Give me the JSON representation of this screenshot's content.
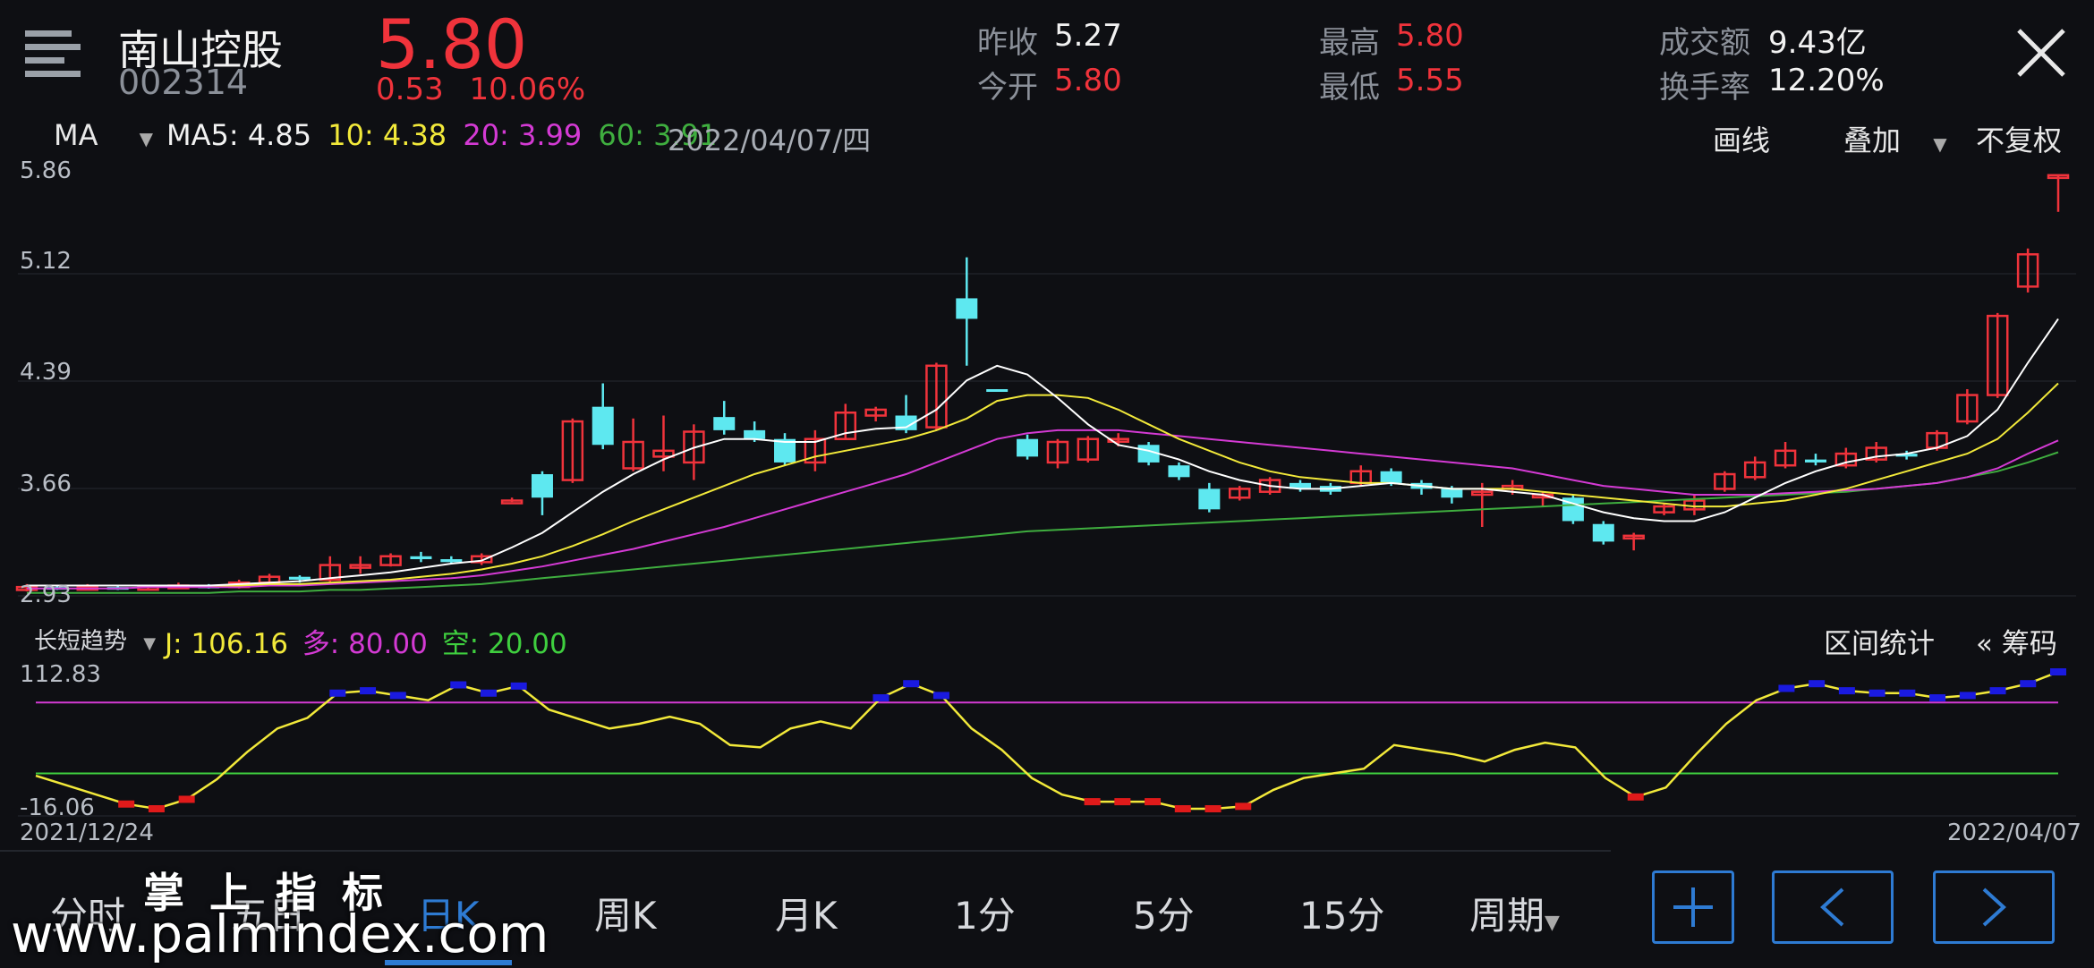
{
  "header": {
    "name": "南山控股",
    "code": "002314",
    "price": "5.80",
    "change": "0.53",
    "change_pct": "10.06%",
    "stats": [
      {
        "label": "昨收",
        "value": "5.27",
        "color": "#f2f2f2"
      },
      {
        "label": "今开",
        "value": "5.80",
        "color": "#f0333b"
      },
      {
        "label": "最高",
        "value": "5.80",
        "color": "#f0333b"
      },
      {
        "label": "最低",
        "value": "5.55",
        "color": "#f0333b"
      },
      {
        "label": "成交额",
        "value": "9.43亿",
        "color": "#f2f2f2"
      },
      {
        "label": "换手率",
        "value": "12.20%",
        "color": "#f2f2f2"
      }
    ]
  },
  "toolbar": {
    "indicator": "MA",
    "ma5": "MA5: 4.85",
    "ma10": "10: 4.38",
    "ma20": "20: 3.99",
    "ma60": "60: 3.91",
    "date": "2022/04/07/四",
    "draw": "画线",
    "overlay": "叠加",
    "adjust": "不复权"
  },
  "colors": {
    "up": "#f0333b",
    "down": "#5ee8f0",
    "ma5": "#ffffff",
    "ma10": "#f2e93a",
    "ma20": "#d43ad4",
    "ma60": "#3fae3f"
  },
  "chart_data": {
    "type": "candlestick",
    "y_ticks": [
      "5.86",
      "5.12",
      "4.39",
      "3.66",
      "2.93"
    ],
    "ylim": [
      2.93,
      5.86
    ],
    "x_labels": {
      "start": "2021/12/24",
      "end": "2022/04/07"
    },
    "candles": [
      [
        2.97,
        2.99,
        3.01,
        2.96
      ],
      [
        2.99,
        2.98,
        3.0,
        2.97
      ],
      [
        2.98,
        2.99,
        3.01,
        2.97
      ],
      [
        2.99,
        2.98,
        3.0,
        2.97
      ],
      [
        2.98,
        2.99,
        3.0,
        2.97
      ],
      [
        2.99,
        3.0,
        3.02,
        2.98
      ],
      [
        3.0,
        2.99,
        3.01,
        2.98
      ],
      [
        2.99,
        3.02,
        3.04,
        2.98
      ],
      [
        3.02,
        3.06,
        3.08,
        3.01
      ],
      [
        3.06,
        3.04,
        3.07,
        3.02
      ],
      [
        3.04,
        3.14,
        3.2,
        3.02
      ],
      [
        3.14,
        3.14,
        3.2,
        3.08
      ],
      [
        3.14,
        3.2,
        3.22,
        3.13
      ],
      [
        3.2,
        3.18,
        3.23,
        3.16
      ],
      [
        3.18,
        3.16,
        3.2,
        3.15
      ],
      [
        3.16,
        3.2,
        3.22,
        3.14
      ],
      [
        3.58,
        3.58,
        3.6,
        3.57
      ],
      [
        3.76,
        3.6,
        3.78,
        3.48
      ],
      [
        3.72,
        4.12,
        4.14,
        3.7
      ],
      [
        4.22,
        3.96,
        4.38,
        3.93
      ],
      [
        3.8,
        3.98,
        4.14,
        3.78
      ],
      [
        3.88,
        3.92,
        4.16,
        3.78
      ],
      [
        3.84,
        4.05,
        4.1,
        3.72
      ],
      [
        4.15,
        4.06,
        4.26,
        4.03
      ],
      [
        4.06,
        4.0,
        4.12,
        3.98
      ],
      [
        4.0,
        3.84,
        4.04,
        3.82
      ],
      [
        3.84,
        4.0,
        4.06,
        3.78
      ],
      [
        4.0,
        4.18,
        4.24,
        4.0
      ],
      [
        4.16,
        4.2,
        4.22,
        4.12
      ],
      [
        4.16,
        4.06,
        4.3,
        4.04
      ],
      [
        4.08,
        4.5,
        4.52,
        4.06
      ],
      [
        4.96,
        4.82,
        5.24,
        4.5
      ],
      [
        4.34,
        4.33,
        4.34,
        4.33
      ],
      [
        4.0,
        3.88,
        4.03,
        3.86
      ],
      [
        3.84,
        3.98,
        4.0,
        3.8
      ],
      [
        3.86,
        4.0,
        4.02,
        3.84
      ],
      [
        3.99,
        4.0,
        4.04,
        3.95
      ],
      [
        3.96,
        3.84,
        3.98,
        3.82
      ],
      [
        3.82,
        3.74,
        3.84,
        3.72
      ],
      [
        3.66,
        3.52,
        3.7,
        3.5
      ],
      [
        3.6,
        3.66,
        3.68,
        3.58
      ],
      [
        3.64,
        3.72,
        3.74,
        3.62
      ],
      [
        3.7,
        3.66,
        3.72,
        3.64
      ],
      [
        3.68,
        3.64,
        3.7,
        3.62
      ],
      [
        3.7,
        3.78,
        3.82,
        3.68
      ],
      [
        3.78,
        3.7,
        3.8,
        3.68
      ],
      [
        3.7,
        3.66,
        3.72,
        3.62
      ],
      [
        3.66,
        3.6,
        3.68,
        3.56
      ],
      [
        3.62,
        3.64,
        3.7,
        3.4
      ],
      [
        3.66,
        3.68,
        3.72,
        3.62
      ],
      [
        3.62,
        3.62,
        3.64,
        3.54
      ],
      [
        3.6,
        3.44,
        3.62,
        3.42
      ],
      [
        3.42,
        3.3,
        3.44,
        3.28
      ],
      [
        3.34,
        3.34,
        3.36,
        3.24
      ],
      [
        3.5,
        3.54,
        3.56,
        3.48
      ],
      [
        3.52,
        3.58,
        3.62,
        3.48
      ],
      [
        3.66,
        3.76,
        3.78,
        3.64
      ],
      [
        3.74,
        3.84,
        3.88,
        3.72
      ],
      [
        3.82,
        3.92,
        3.98,
        3.8
      ],
      [
        3.86,
        3.84,
        3.9,
        3.82
      ],
      [
        3.82,
        3.9,
        3.94,
        3.8
      ],
      [
        3.86,
        3.94,
        3.98,
        3.84
      ],
      [
        3.9,
        3.88,
        3.92,
        3.86
      ],
      [
        3.94,
        4.04,
        4.06,
        3.92
      ],
      [
        4.12,
        4.3,
        4.34,
        4.1
      ],
      [
        4.3,
        4.84,
        4.86,
        4.28
      ],
      [
        5.04,
        5.26,
        5.3,
        5.0
      ],
      [
        5.8,
        5.8,
        5.8,
        5.55
      ]
    ],
    "ma5": [
      3.0,
      3.0,
      3.0,
      3.0,
      3.0,
      3.0,
      3.0,
      3.01,
      3.02,
      3.03,
      3.05,
      3.07,
      3.09,
      3.12,
      3.15,
      3.17,
      3.26,
      3.36,
      3.5,
      3.64,
      3.76,
      3.86,
      3.94,
      4.0,
      4.0,
      3.98,
      3.98,
      4.04,
      4.07,
      4.08,
      4.2,
      4.4,
      4.5,
      4.44,
      4.28,
      4.1,
      3.96,
      3.92,
      3.86,
      3.78,
      3.72,
      3.68,
      3.66,
      3.66,
      3.68,
      3.7,
      3.68,
      3.66,
      3.66,
      3.64,
      3.62,
      3.56,
      3.5,
      3.46,
      3.44,
      3.44,
      3.5,
      3.6,
      3.7,
      3.78,
      3.84,
      3.88,
      3.9,
      3.94,
      4.02,
      4.2,
      4.52,
      4.82
    ],
    "ma10": [
      3.0,
      3.0,
      3.0,
      3.0,
      3.0,
      3.0,
      3.0,
      3.0,
      3.01,
      3.01,
      3.02,
      3.03,
      3.04,
      3.06,
      3.08,
      3.11,
      3.15,
      3.2,
      3.27,
      3.35,
      3.44,
      3.52,
      3.6,
      3.68,
      3.76,
      3.82,
      3.88,
      3.92,
      3.96,
      4.0,
      4.06,
      4.14,
      4.26,
      4.3,
      4.3,
      4.28,
      4.2,
      4.1,
      4.0,
      3.92,
      3.84,
      3.78,
      3.74,
      3.72,
      3.7,
      3.7,
      3.68,
      3.66,
      3.66,
      3.66,
      3.64,
      3.62,
      3.6,
      3.58,
      3.56,
      3.54,
      3.54,
      3.56,
      3.58,
      3.62,
      3.66,
      3.72,
      3.78,
      3.84,
      3.9,
      4.0,
      4.18,
      4.38
    ],
    "ma20": [
      2.98,
      2.98,
      2.98,
      2.98,
      2.99,
      2.99,
      2.99,
      2.99,
      3.0,
      3.0,
      3.01,
      3.02,
      3.03,
      3.04,
      3.05,
      3.07,
      3.1,
      3.13,
      3.17,
      3.21,
      3.25,
      3.3,
      3.35,
      3.4,
      3.46,
      3.52,
      3.58,
      3.64,
      3.7,
      3.76,
      3.84,
      3.92,
      4.0,
      4.04,
      4.06,
      4.06,
      4.06,
      4.04,
      4.02,
      4.0,
      3.98,
      3.96,
      3.94,
      3.92,
      3.9,
      3.88,
      3.86,
      3.84,
      3.82,
      3.8,
      3.76,
      3.72,
      3.68,
      3.66,
      3.64,
      3.62,
      3.62,
      3.62,
      3.63,
      3.64,
      3.65,
      3.66,
      3.68,
      3.7,
      3.74,
      3.8,
      3.9,
      3.99
    ],
    "ma60": [
      2.95,
      2.95,
      2.95,
      2.95,
      2.95,
      2.95,
      2.95,
      2.96,
      2.96,
      2.96,
      2.97,
      2.97,
      2.98,
      2.99,
      3.0,
      3.01,
      3.03,
      3.05,
      3.07,
      3.09,
      3.11,
      3.13,
      3.15,
      3.17,
      3.19,
      3.21,
      3.23,
      3.25,
      3.27,
      3.29,
      3.31,
      3.33,
      3.35,
      3.37,
      3.38,
      3.39,
      3.4,
      3.41,
      3.42,
      3.43,
      3.44,
      3.45,
      3.46,
      3.47,
      3.48,
      3.49,
      3.5,
      3.51,
      3.52,
      3.53,
      3.54,
      3.55,
      3.56,
      3.57,
      3.58,
      3.59,
      3.6,
      3.61,
      3.62,
      3.63,
      3.64,
      3.66,
      3.68,
      3.7,
      3.74,
      3.78,
      3.84,
      3.91
    ]
  },
  "indicator": {
    "name": "长短趋势",
    "j": "J: 106.16",
    "duo": "多: 80.00",
    "kong": "空: 20.00",
    "y_top": "112.83",
    "y_bottom": "-16.06",
    "range_stats": "区间统计",
    "chips": "« 筹码",
    "j_values": [
      18,
      10,
      2,
      -6,
      -10,
      -2,
      15,
      38,
      58,
      67,
      88,
      90,
      86,
      82,
      95,
      88,
      94,
      74,
      66,
      58,
      62,
      68,
      62,
      44,
      42,
      58,
      64,
      58,
      84,
      96,
      86,
      58,
      40,
      16,
      2,
      -4,
      -4,
      -4,
      -10,
      -10,
      -8,
      6,
      16,
      20,
      24,
      44,
      40,
      36,
      30,
      40,
      46,
      42,
      16,
      0,
      8,
      36,
      62,
      82,
      92,
      96,
      90,
      88,
      88,
      84,
      86,
      90,
      96,
      106
    ]
  },
  "tabs": [
    "分时",
    "五日",
    "日K",
    "周K",
    "月K",
    "1分",
    "5分",
    "15分",
    "周期"
  ],
  "active_tab": "日K",
  "watermark": {
    "chars": "掌上指标",
    "url": "www.palmindex.com"
  }
}
